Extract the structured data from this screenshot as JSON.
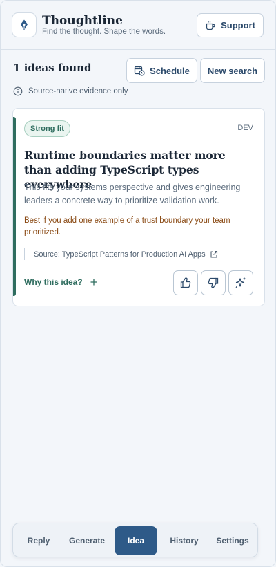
{
  "app": {
    "name": "Thoughtline",
    "tagline": "Find the thought. Shape the words.",
    "support_label": "Support"
  },
  "results": {
    "title": "1 ideas found",
    "schedule_label": "Schedule",
    "new_search_label": "New search",
    "note": "Source-native evidence only"
  },
  "idea": {
    "badge": "Strong fit",
    "platform": "DEV",
    "title": "Runtime boundaries matter more than adding TypeScript types everywhere",
    "description": "This fits your systems perspective and gives engineering leaders a concrete way to prioritize validation work.",
    "tip": "Best if you add one example of a trust boundary your team prioritized.",
    "source": "Source: TypeScript Patterns for Production AI Apps",
    "why_label": "Why this idea?"
  },
  "nav": {
    "items": [
      {
        "label": "Reply"
      },
      {
        "label": "Generate"
      },
      {
        "label": "Idea"
      },
      {
        "label": "History"
      },
      {
        "label": "Settings"
      }
    ],
    "active": "Idea"
  },
  "colors": {
    "accent": "#2e5a88",
    "fit_green": "#2f6d5f",
    "tip_brown": "#8a4a14",
    "background": "#f3f6fa"
  }
}
